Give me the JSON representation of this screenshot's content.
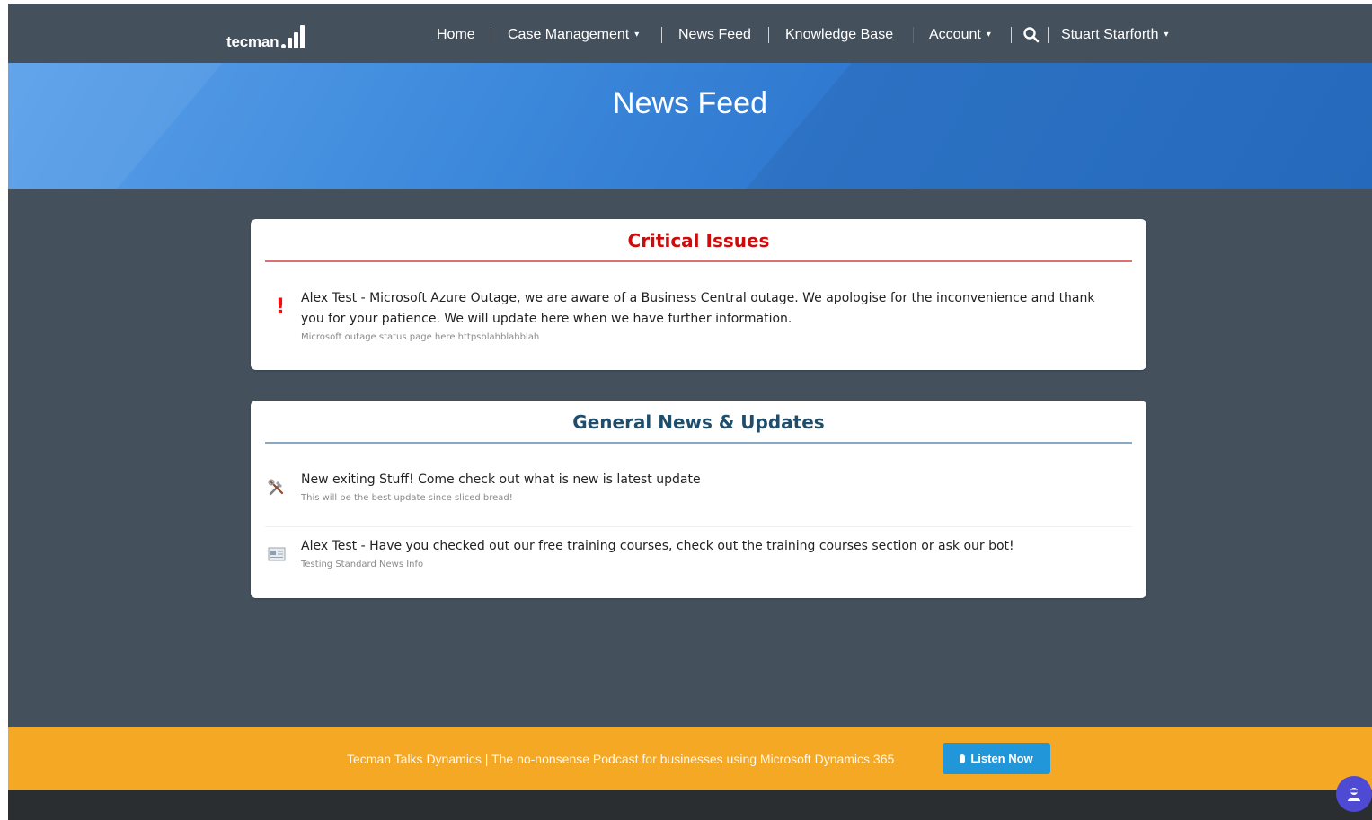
{
  "brand": {
    "logo_text": "tecman"
  },
  "nav": {
    "home": "Home",
    "case_management": "Case Management",
    "news_feed": "News Feed",
    "knowledge_base": "Knowledge Base",
    "account": "Account",
    "user": "Stuart Starforth",
    "caret": "▾"
  },
  "hero": {
    "title": "News Feed"
  },
  "critical": {
    "title": "Critical Issues",
    "items": [
      {
        "icon": "exclamation-icon",
        "text": "Alex Test - Microsoft Azure Outage, we are aware of a Business Central outage. We apologise for the inconvenience and thank you for your patience. We will update here when we have further information.",
        "sub": "Microsoft outage status page here httpsblahblahblah"
      }
    ]
  },
  "general": {
    "title": "General News & Updates",
    "items": [
      {
        "icon": "tools-icon",
        "text": "New exiting Stuff! Come check out what is new is latest update",
        "sub": "This will be the best update since sliced bread!"
      },
      {
        "icon": "newspaper-icon",
        "text": "Alex Test - Have you checked out our free training courses, check out the training courses section or ask our bot!",
        "sub": "Testing Standard News Info"
      }
    ]
  },
  "promo": {
    "text": "Tecman Talks Dynamics | The no-nonsense Podcast for businesses using Microsoft Dynamics 365",
    "button": "Listen Now"
  },
  "colors": {
    "nav_bg": "#44505c",
    "hero_blue": "#3b87da",
    "critical_red": "#cc0b0b",
    "general_title": "#1f4d6a",
    "promo_orange": "#f4a823",
    "button_blue": "#2196d8",
    "chat_purple": "#4e4ad4"
  }
}
